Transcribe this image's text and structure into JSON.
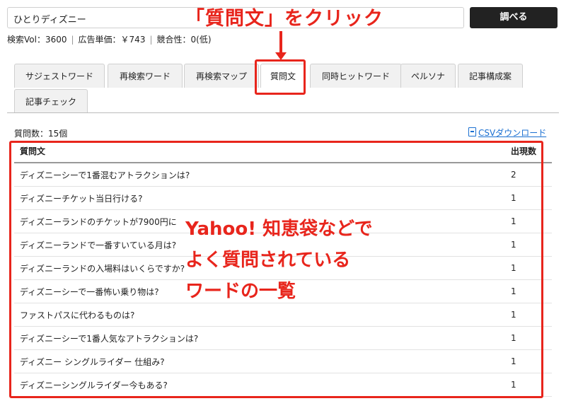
{
  "search": {
    "value": "ひとりディズニー",
    "button_label": "調べる"
  },
  "metrics": {
    "volume": "検索Vol：3600",
    "cpc": "広告単価：￥743",
    "competition": "競合性：0(低)"
  },
  "tabs": [
    {
      "label": "サジェストワード"
    },
    {
      "label": "再検索ワード"
    },
    {
      "label": "再検索マップ"
    },
    {
      "label": "質問文",
      "active": true
    },
    {
      "label": "同時ヒットワード"
    },
    {
      "label": "ペルソナ"
    },
    {
      "label": "記事構成案"
    },
    {
      "label": "記事チェック"
    }
  ],
  "question_count": "質問数：15個",
  "csv_label": "CSVダウンロード",
  "table": {
    "headers": [
      "質問文",
      "出現数"
    ],
    "rows": [
      [
        "ディズニーシーで1番混むアトラクションは?",
        "2"
      ],
      [
        "ディズニーチケット当日行ける?",
        "1"
      ],
      [
        "ディズニーランドのチケットが7900円に",
        "1"
      ],
      [
        "ディズニーランドで一番すいている月は?",
        "1"
      ],
      [
        "ディズニーランドの入場料はいくらですか?",
        "1"
      ],
      [
        "ディズニーシーで一番怖い乗り物は?",
        "1"
      ],
      [
        "ファストパスに代わるものは?",
        "1"
      ],
      [
        "ディズニーシーで1番人気なアトラクションは?",
        "1"
      ],
      [
        "ディズニー シングルライダー 仕組み?",
        "1"
      ],
      [
        "ディズニーシングルライダー今もある?",
        "1"
      ]
    ]
  },
  "annotations": {
    "top": "「質問文」をクリック",
    "center": [
      "Yahoo! 知恵袋などで",
      "よく質問されている",
      "ワードの一覧"
    ],
    "color": "#e8251c"
  }
}
